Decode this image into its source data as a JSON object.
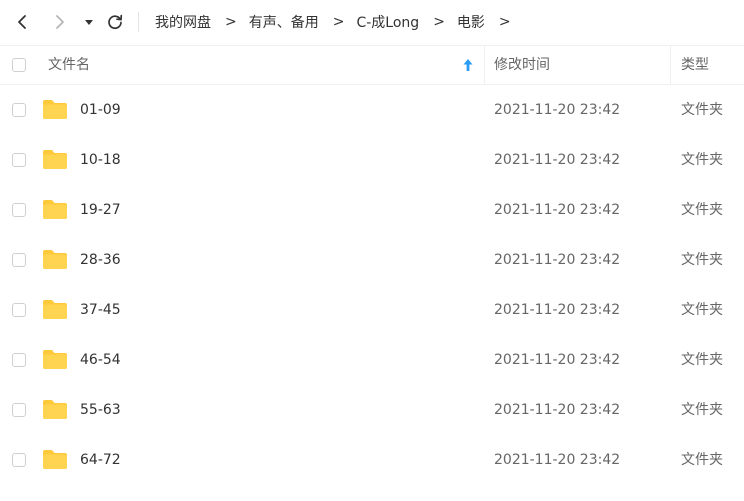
{
  "icons": {
    "back": "chevron-left-icon",
    "forward": "chevron-right-icon",
    "history": "caret-down-icon",
    "refresh": "refresh-icon",
    "sort": "arrow-up-icon",
    "folder": "folder-icon"
  },
  "colors": {
    "folder": "#FFC93C",
    "sort_arrow": "#2A9BF4",
    "text": "#333333",
    "muted": "#666666"
  },
  "breadcrumb": {
    "items": [
      {
        "label": "我的网盘"
      },
      {
        "label": "有声、备用"
      },
      {
        "label": "C-成Long"
      },
      {
        "label": "电影"
      }
    ],
    "separator": ">"
  },
  "columns": {
    "name": "文件名",
    "modified": "修改时间",
    "type": "类型"
  },
  "files": [
    {
      "name": "01-09",
      "modified": "2021-11-20 23:42",
      "type": "文件夹"
    },
    {
      "name": "10-18",
      "modified": "2021-11-20 23:42",
      "type": "文件夹"
    },
    {
      "name": "19-27",
      "modified": "2021-11-20 23:42",
      "type": "文件夹"
    },
    {
      "name": "28-36",
      "modified": "2021-11-20 23:42",
      "type": "文件夹"
    },
    {
      "name": "37-45",
      "modified": "2021-11-20 23:42",
      "type": "文件夹"
    },
    {
      "name": "46-54",
      "modified": "2021-11-20 23:42",
      "type": "文件夹"
    },
    {
      "name": "55-63",
      "modified": "2021-11-20 23:42",
      "type": "文件夹"
    },
    {
      "name": "64-72",
      "modified": "2021-11-20 23:42",
      "type": "文件夹"
    }
  ]
}
